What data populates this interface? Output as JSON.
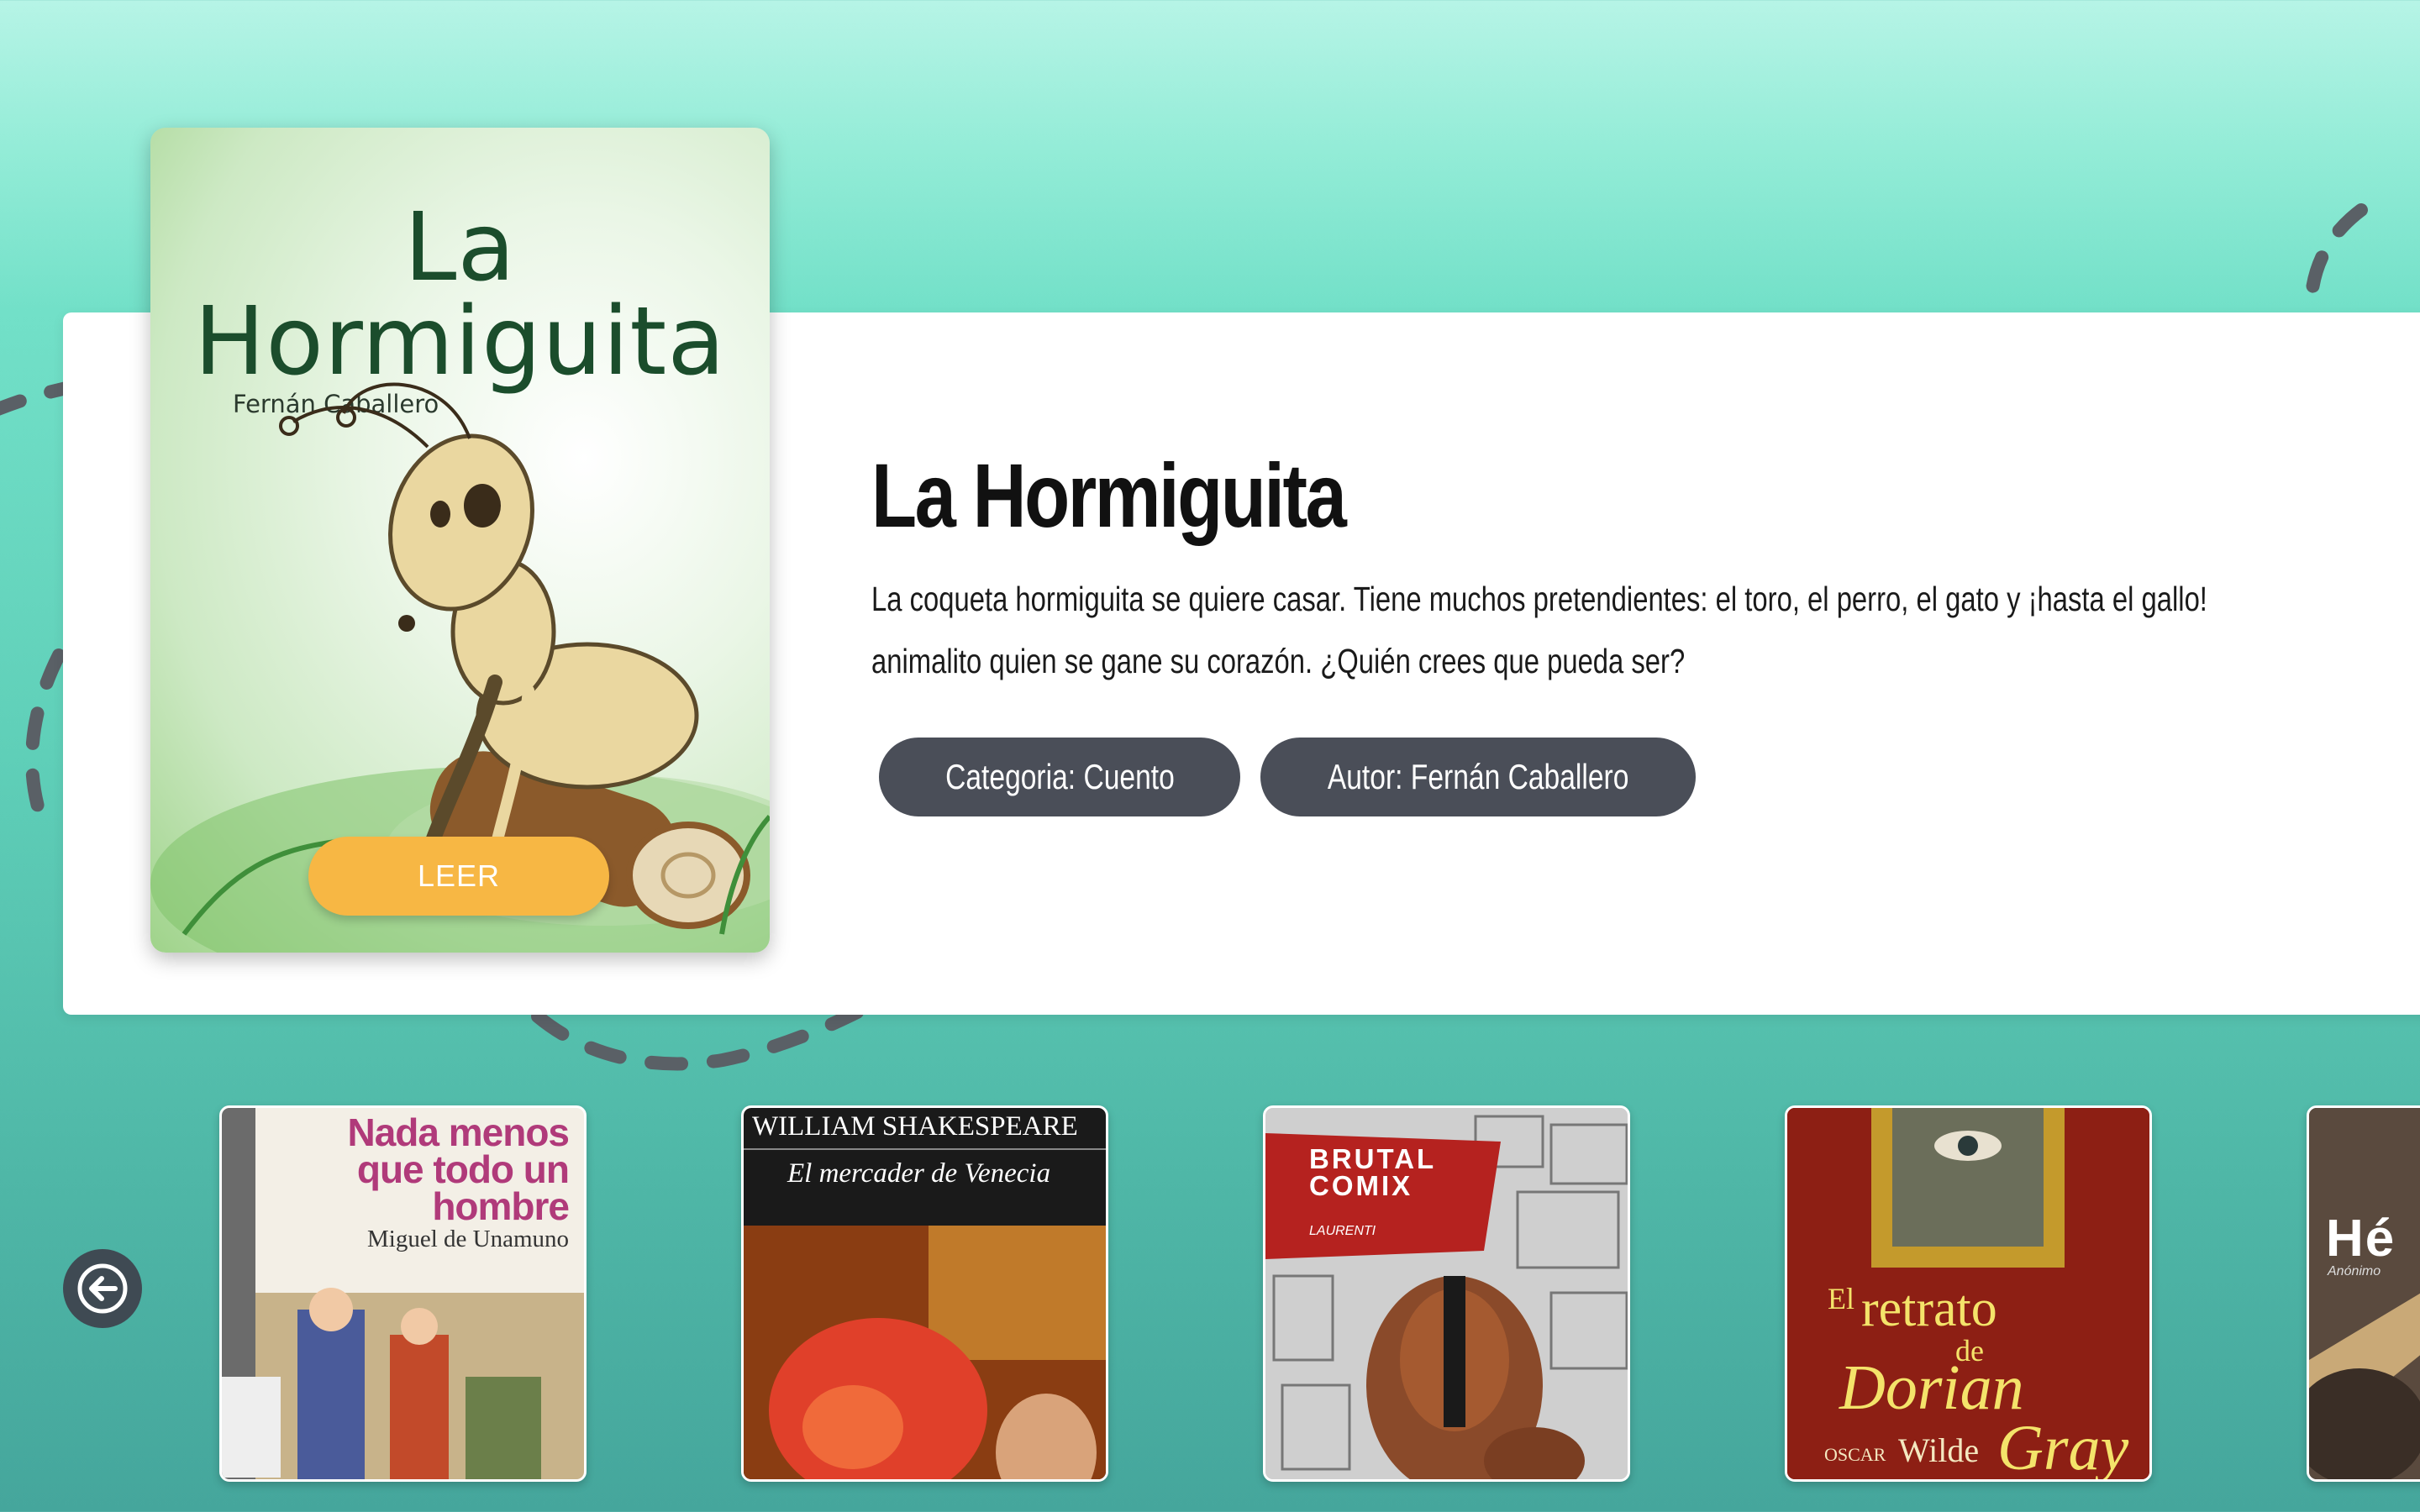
{
  "book": {
    "cover_title_line1": "La",
    "cover_title_line2": "Hormiguita",
    "cover_author": "Fernán Caballero",
    "read_label": "LEER",
    "title": "La Hormiguita",
    "description_line1": "La coqueta hormiguita se quiere casar. Tiene muchos pretendientes: el toro, el perro, el gato y ¡hasta el gallo!",
    "description_line2": "animalito quien se gane su corazón. ¿Quién crees que pueda ser?",
    "category_label": "Categoria: Cuento",
    "author_label": "Autor: Fernán Caballero"
  },
  "carousel": {
    "prev_icon": "arrow-left-icon",
    "items": [
      {
        "title_l1": "Nada menos",
        "title_l2": "que todo un",
        "title_l3": "hombre",
        "author": "Miguel de Unamuno"
      },
      {
        "author": "WILLIAM SHAKESPEARE",
        "title": "El mercader de Venecia"
      },
      {
        "title_l1": "BRUTAL",
        "title_l2": "COMIX",
        "author": "LAURENTI"
      },
      {
        "prefix": "El",
        "title_l1": "retrato",
        "title_l2": "de",
        "title_l3": "Dorian",
        "title_l4": "Gray",
        "author_first": "OSCAR",
        "author_last": "Wilde"
      },
      {
        "title": "Hé",
        "subtitle": "Anónimo"
      }
    ]
  },
  "colors": {
    "read_button": "#f7b744",
    "pill": "#4a4e58",
    "arrow_button": "#3f4a53",
    "dash": "#5a5f66"
  }
}
